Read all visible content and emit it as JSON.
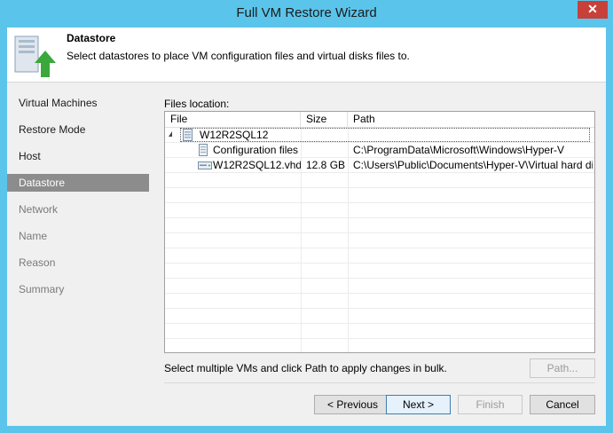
{
  "window": {
    "title": "Full VM Restore Wizard",
    "close_glyph": "✕"
  },
  "header": {
    "title": "Datastore",
    "subtitle": "Select datastores to place VM configuration files and virtual disks files to."
  },
  "nav": {
    "items": [
      {
        "label": "Virtual Machines",
        "state": "normal"
      },
      {
        "label": "Restore Mode",
        "state": "normal"
      },
      {
        "label": "Host",
        "state": "normal"
      },
      {
        "label": "Datastore",
        "state": "active"
      },
      {
        "label": "Network",
        "state": "disabled"
      },
      {
        "label": "Name",
        "state": "disabled"
      },
      {
        "label": "Reason",
        "state": "disabled"
      },
      {
        "label": "Summary",
        "state": "disabled"
      }
    ]
  },
  "files": {
    "label": "Files location:",
    "columns": {
      "file": "File",
      "size": "Size",
      "path": "Path"
    },
    "vm_name": "W12R2SQL12",
    "rows": [
      {
        "file": "Configuration files",
        "size": "",
        "path": "C:\\ProgramData\\Microsoft\\Windows\\Hyper-V",
        "icon": "document-icon"
      },
      {
        "file": "W12R2SQL12.vhdx",
        "size": "12.8 GB",
        "path": "C:\\Users\\Public\\Documents\\Hyper-V\\Virtual hard disks",
        "icon": "disk-icon"
      }
    ]
  },
  "hint": "Select multiple VMs and click Path to apply changes in bulk.",
  "buttons": {
    "path": "Path...",
    "previous": "< Previous",
    "next": "Next >",
    "finish": "Finish",
    "cancel": "Cancel"
  },
  "colors": {
    "titlebar": "#5bc4ea",
    "close": "#c7413a",
    "active_nav": "#8c8c8c",
    "arrow": "#3aa83a"
  }
}
